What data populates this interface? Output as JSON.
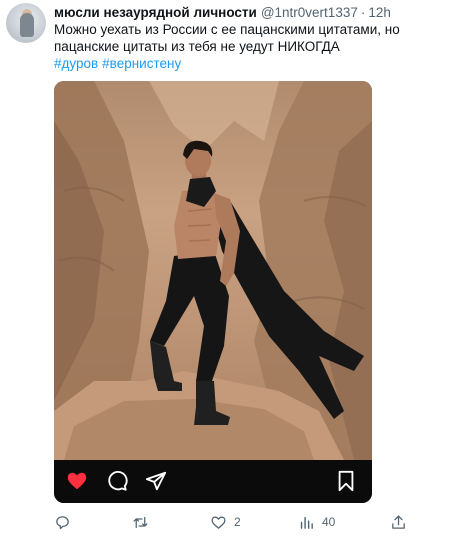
{
  "tweet": {
    "display_name": "мюсли незаурядной личности",
    "handle": "@1ntr0vert1337",
    "separator": "·",
    "time": "12h",
    "text": "Можно уехать из России с ее пацанскими цитатами, но пацанские цитаты из тебя не уедут НИКОГДА",
    "hashtags": [
      "#дуров",
      "#вернистену"
    ]
  },
  "media": {
    "overlay_icons": [
      "heart-icon",
      "comment-icon",
      "send-icon",
      "bookmark-icon"
    ],
    "like_color": "#ff3040"
  },
  "actions": {
    "reply_count": "",
    "retweet_count": "",
    "like_count": "2",
    "views_count": "40"
  },
  "colors": {
    "text": "#0f1419",
    "secondary": "#536471",
    "hashtag": "#1d9bf0"
  }
}
